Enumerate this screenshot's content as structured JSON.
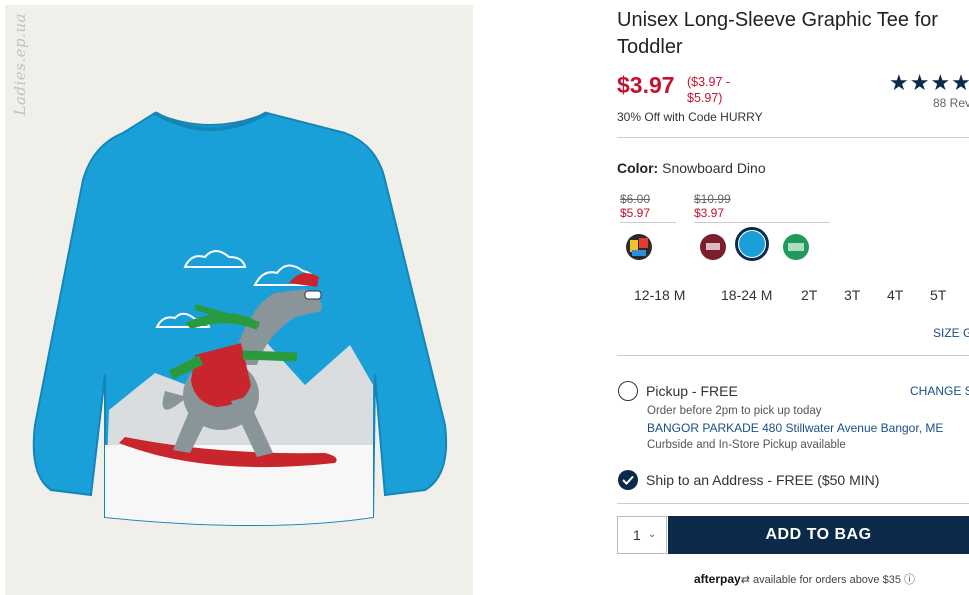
{
  "image": {
    "watermark": "Ladies.ep.ua",
    "alt": "Product image"
  },
  "product": {
    "title": "Unisex Long-Sleeve Graphic Tee for Toddler",
    "price": "$3.97",
    "price_range": "($3.97 - $5.97)",
    "promo": "30% Off with Code HURRY",
    "stars": "★★★★",
    "reviews": "88 Rev"
  },
  "color": {
    "label": "Color:",
    "value": "Snowboard Dino",
    "groups": [
      {
        "original": "$6.00",
        "sale": "$5.97"
      },
      {
        "original": "$10.99",
        "sale": "$3.97"
      }
    ]
  },
  "sizes": [
    "12-18 M",
    "18-24 M",
    "2T",
    "3T",
    "4T",
    "5T"
  ],
  "size_guide": "SIZE G",
  "fulfillment": {
    "pickup_label": "Pickup - FREE",
    "change_store": "CHANGE ST",
    "pickup_note": "Order before 2pm to pick up today",
    "store_name": "BANGOR PARKADE 480 Stillwater Avenue  Bangor, ME",
    "curbside": "Curbside and In-Store Pickup available",
    "ship_label": "Ship to an Address - FREE ($50 MIN)"
  },
  "cart": {
    "qty": "1",
    "chevron": "⌄",
    "add_label": "ADD TO BAG"
  },
  "afterpay": {
    "brand": "afterpay",
    "text": "available for orders above $35",
    "info": "ⓘ"
  },
  "colors": {
    "accent": "#0b2a4a",
    "sale_red": "#c41230",
    "shirt_blue": "#1aa0d8"
  }
}
